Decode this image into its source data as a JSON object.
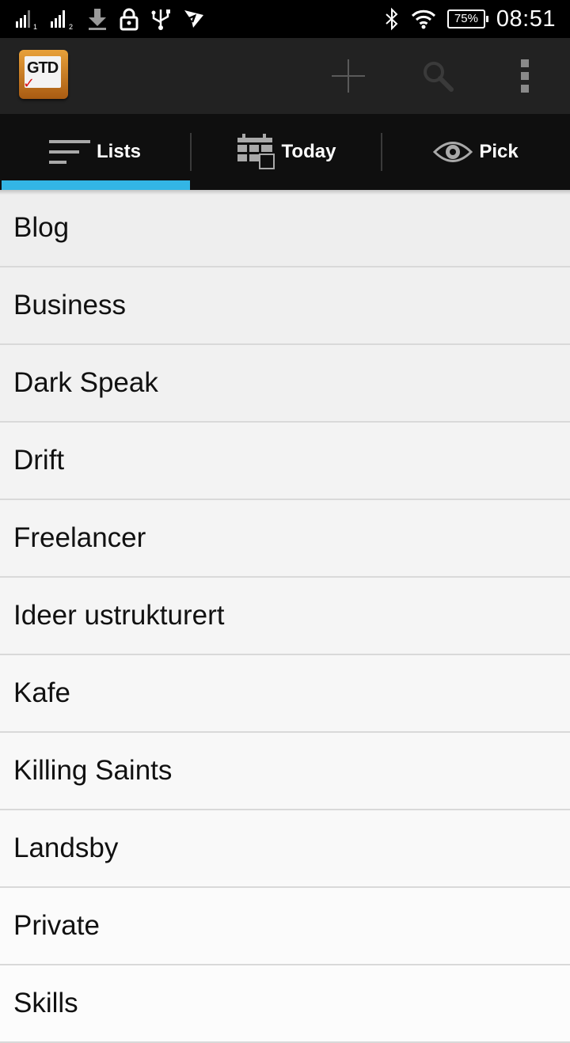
{
  "status_bar": {
    "sim1_label": "1",
    "sim2_label": "2",
    "battery": "75%",
    "time": "08:51",
    "icons": [
      "signal-1-icon",
      "signal-2-icon",
      "download-icon",
      "lock-icon",
      "usb-icon",
      "messenger-icon",
      "bluetooth-icon",
      "wifi-icon",
      "battery-icon"
    ]
  },
  "action_bar": {
    "logo_text": "GTD",
    "actions": [
      "add-icon",
      "search-icon",
      "overflow-menu-icon"
    ]
  },
  "tabs": [
    {
      "label": "Lists",
      "icon": "lists-icon",
      "selected": true
    },
    {
      "label": "Today",
      "icon": "calendar-icon",
      "selected": false
    },
    {
      "label": "Pick",
      "icon": "eye-icon",
      "selected": false
    }
  ],
  "colors": {
    "accent": "#33b5e5",
    "action_bar": "#222222",
    "tab_bar": "#0f0f0f"
  },
  "lists": [
    "Blog",
    "Business",
    "Dark Speak",
    "Drift",
    "Freelancer",
    "Ideer ustrukturert",
    "Kafe",
    "Killing Saints",
    "Landsby",
    "Private",
    "Skills"
  ]
}
